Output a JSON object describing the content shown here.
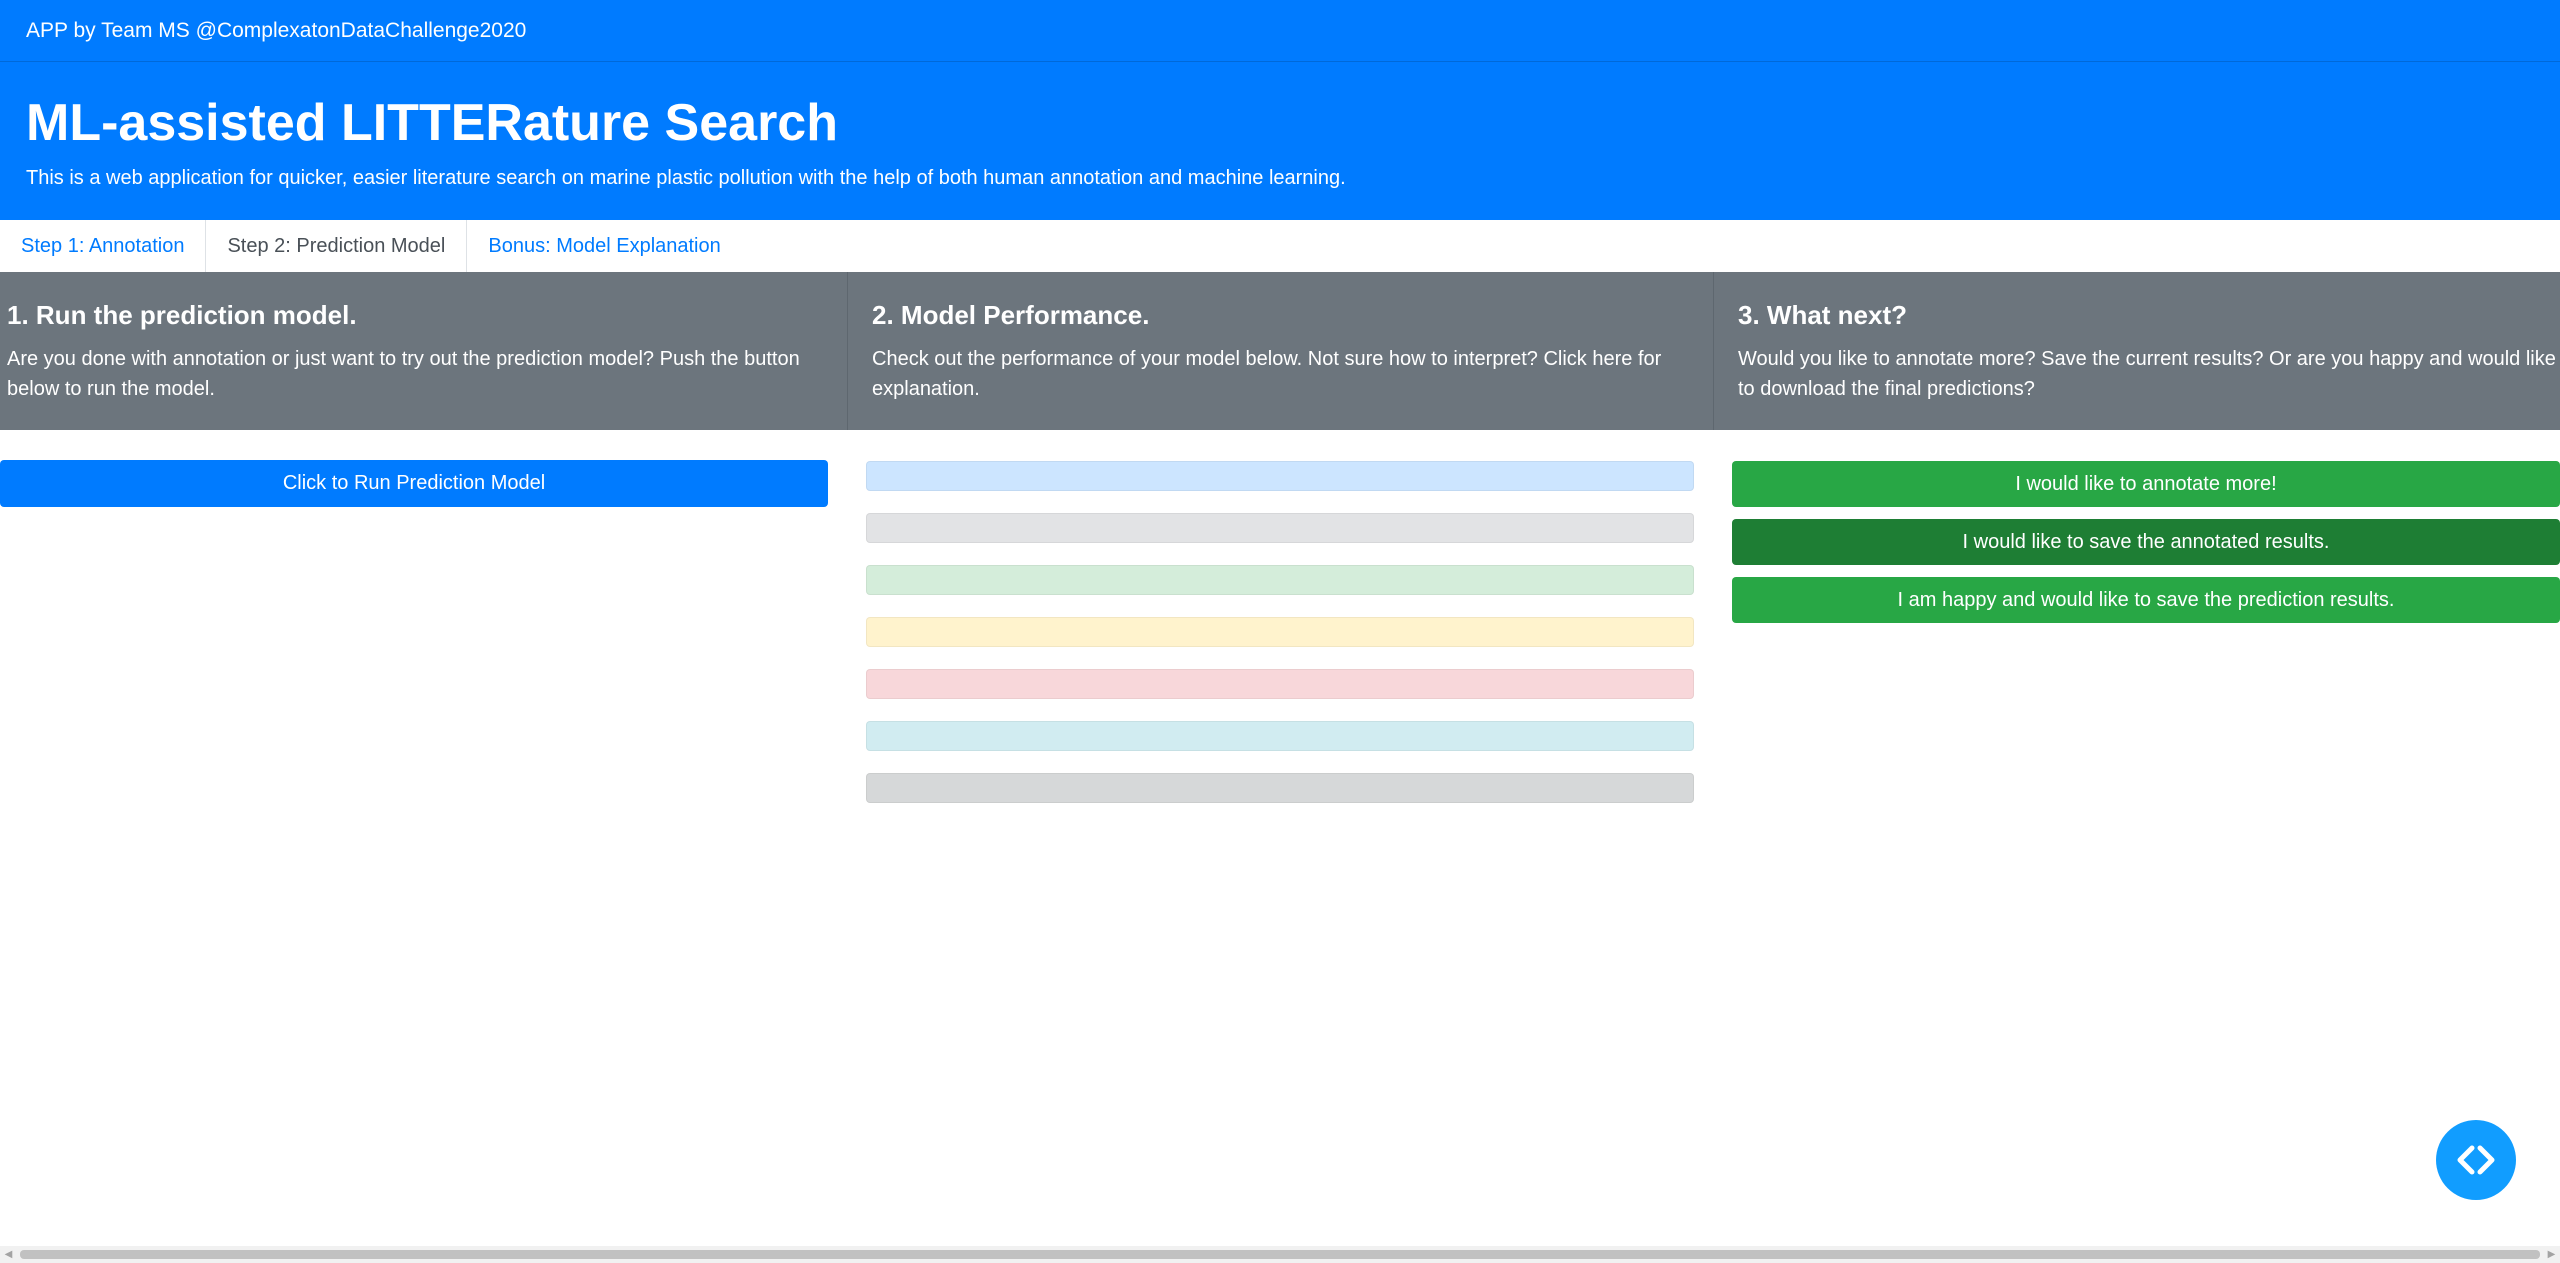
{
  "topbar": {
    "text": "APP by Team MS @ComplexatonDataChallenge2020"
  },
  "hero": {
    "title": "ML-assisted LITTERature Search",
    "description": "This is a web application for quicker, easier literature search on marine plastic pollution with the help of both human annotation and machine learning."
  },
  "tabs": [
    {
      "label": "Step 1: Annotation",
      "active": false
    },
    {
      "label": "Step 2: Prediction Model",
      "active": true
    },
    {
      "label": "Bonus: Model Explanation",
      "active": false
    }
  ],
  "panels": [
    {
      "heading": "1. Run the prediction model.",
      "text": "Are you done with annotation or just want to try out the prediction model? Push the button below to run the model."
    },
    {
      "heading": "2. Model Performance.",
      "text": "Check out the performance of your model below. Not sure how to interpret? Click here for explanation."
    },
    {
      "heading": "3. What next?",
      "text": "Would you like to annotate more? Save the current results? Or are you happy and would like to download the final predictions?"
    }
  ],
  "run_button": {
    "label": "Click to Run Prediction Model",
    "color": "#007bff"
  },
  "performance_bars": [
    {
      "name": "primary",
      "color": "#cce5ff"
    },
    {
      "name": "secondary",
      "color": "#e2e3e5"
    },
    {
      "name": "success",
      "color": "#d4edda"
    },
    {
      "name": "warning",
      "color": "#fff3cd"
    },
    {
      "name": "danger",
      "color": "#f8d7da"
    },
    {
      "name": "info",
      "color": "#d1ecf1"
    },
    {
      "name": "dark",
      "color": "#d6d8d9"
    }
  ],
  "actions": [
    {
      "label": "I would like to annotate more!",
      "color": "#28a745"
    },
    {
      "label": "I would like to save the annotated results.",
      "color": "#1e7e34"
    },
    {
      "label": "I am happy and would like to save the prediction results.",
      "color": "#28a745"
    }
  ],
  "fab": {
    "icon": "code-brackets-icon",
    "color": "#119dff"
  },
  "scrollbar": {
    "left_arrow": "◀",
    "right_arrow": "▶"
  }
}
